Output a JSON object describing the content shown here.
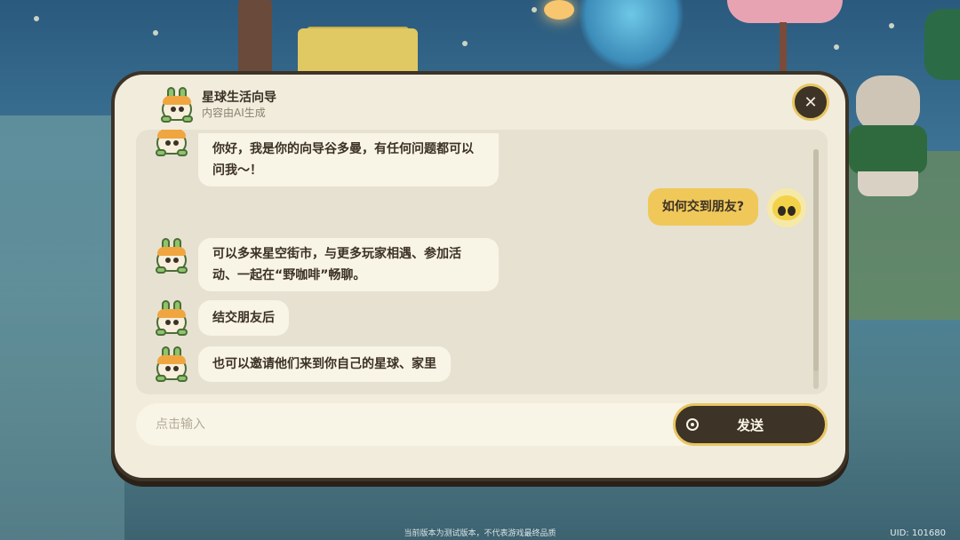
{
  "dialog": {
    "title": "星球生活向导",
    "subtitle": "内容由AI生成",
    "close_icon": "close-icon"
  },
  "messages": [
    {
      "role": "bot",
      "text": "你好，我是你的向导谷多曼，有任何问题都可以问我～！"
    },
    {
      "role": "user",
      "text": "如何交到朋友?"
    },
    {
      "role": "bot",
      "text": "可以多来星空街市，与更多玩家相遇、参加活动、一起在“野咖啡”畅聊。"
    },
    {
      "role": "bot",
      "text": "结交朋友后"
    },
    {
      "role": "bot",
      "text": "也可以邀请他们来到你自己的星球、家里"
    }
  ],
  "input": {
    "placeholder": "点击输入",
    "send_label": "发送"
  },
  "footer": {
    "notice": "当前版本为测试版本，不代表游戏最终品质",
    "uid": "UID: 101680"
  },
  "colors": {
    "dialog_bg": "#f1ecdc",
    "dialog_border": "#3d3326",
    "user_bubble": "#f0c85a",
    "bot_bubble": "#f8f4e6",
    "accent": "#e8c662"
  }
}
